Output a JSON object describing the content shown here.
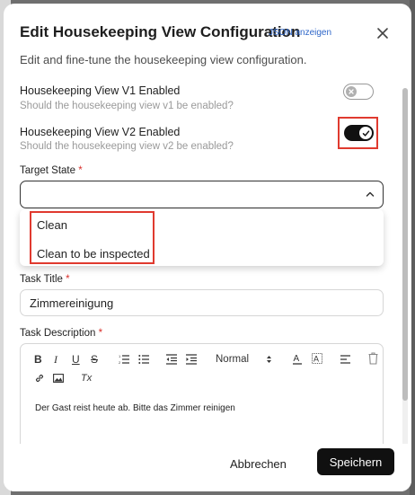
{
  "dialog": {
    "title": "Edit Housekeeping View Configuration",
    "json_link": "JSON anzeigen",
    "subtitle": "Edit and fine-tune the housekeeping view configuration."
  },
  "fields": {
    "v1": {
      "label": "Housekeeping View V1 Enabled",
      "hint": "Should the housekeeping view v1 be enabled?",
      "enabled": false
    },
    "v2": {
      "label": "Housekeeping View V2 Enabled",
      "hint": "Should the housekeeping view v2 be enabled?",
      "enabled": true
    },
    "target_state": {
      "label": "Target State",
      "required_mark": "*",
      "value": "",
      "options": [
        "Clean",
        "Clean to be inspected"
      ]
    },
    "task_title": {
      "label": "Task Title",
      "required_mark": "*",
      "value": "Zimmereinigung"
    },
    "task_description": {
      "label": "Task Description",
      "required_mark": "*",
      "toolbar": {
        "bold": "B",
        "italic": "I",
        "underline": "U",
        "strike": "S",
        "font_size": "Normal",
        "clear_format": "Tx"
      },
      "value": "Der Gast reist heute ab. Bitte das Zimmer reinigen"
    }
  },
  "footer": {
    "cancel_label": "Abbrechen",
    "save_label": "Speichern"
  },
  "colors": {
    "primary": "#101010",
    "link": "#2f67c9",
    "required": "#d9302c",
    "highlight": "#e03a2f"
  }
}
